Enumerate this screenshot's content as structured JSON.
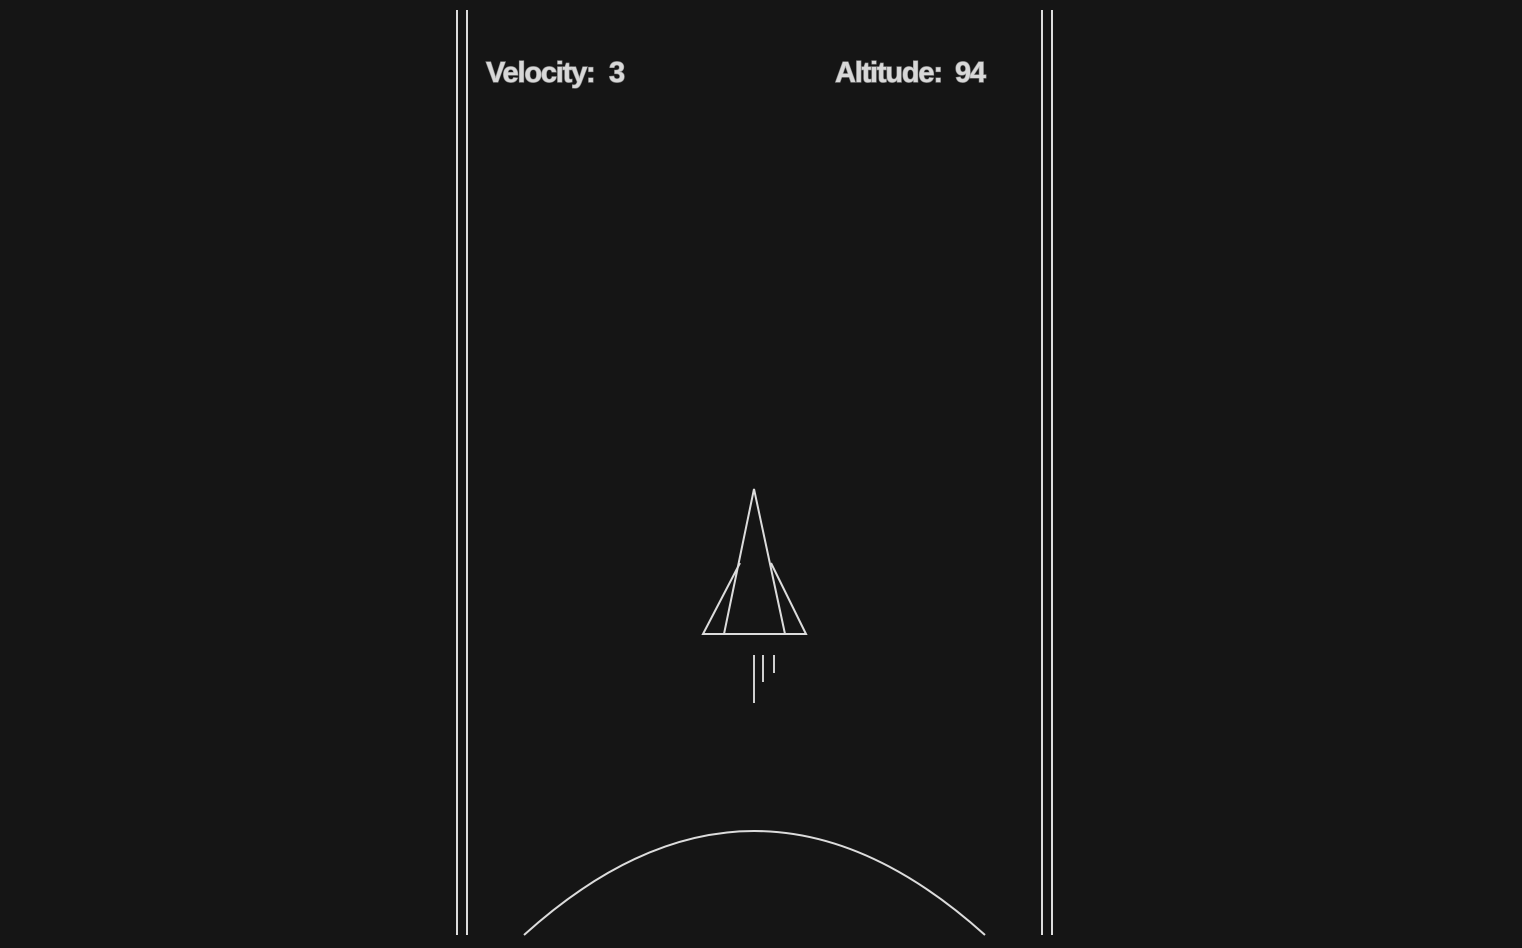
{
  "hud": {
    "velocity_label": "Velocity:",
    "velocity_value": "3",
    "altitude_label": "Altitude:",
    "altitude_value": "94"
  },
  "colors": {
    "background": "#151515",
    "line": "#dcdcdc",
    "text": "#d8d8d8"
  },
  "icons": {
    "ship": "rocket-ship-icon",
    "planet": "planet-arc-icon"
  }
}
